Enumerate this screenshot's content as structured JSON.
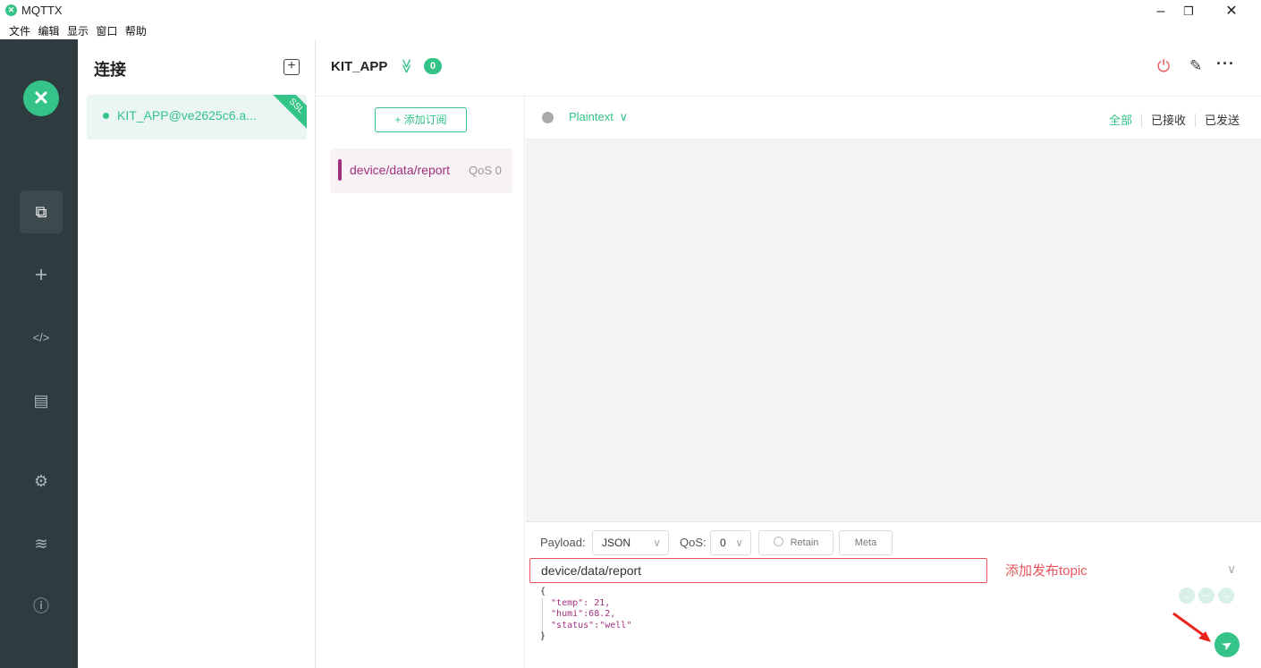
{
  "window": {
    "title": "MQTTX",
    "minimize": "–",
    "restore": "❐",
    "close": "✕"
  },
  "menu": [
    "文件",
    "编辑",
    "显示",
    "窗口",
    "帮助"
  ],
  "nav": {
    "logo": "✕",
    "items": [
      {
        "name": "connections-icon",
        "glyph": "⧉",
        "active": true
      },
      {
        "name": "new-connection-icon",
        "glyph": "+",
        "active": false
      },
      {
        "name": "script-icon",
        "glyph": "</>",
        "active": false
      },
      {
        "name": "log-icon",
        "glyph": "▤",
        "active": false
      },
      {
        "name": "settings-icon",
        "glyph": "⚙",
        "active": false
      },
      {
        "name": "feed-icon",
        "glyph": "≋",
        "active": false
      },
      {
        "name": "about-icon",
        "glyph": "ⓘ",
        "active": false
      }
    ]
  },
  "connections": {
    "title": "连接",
    "add_glyph": "+",
    "items": [
      {
        "name": "KIT_APP@ve2625c6.a...",
        "tag": "SSL",
        "status_color": "#34c388"
      }
    ]
  },
  "header": {
    "title": "KIT_APP",
    "chevron": "≫",
    "badge": "0",
    "power_glyph": "⏻",
    "edit_glyph": "✎",
    "more_glyph": "···"
  },
  "subscriptions": {
    "add_label": "+ 添加订阅",
    "items": [
      {
        "topic": "device/data/report",
        "qos": "QoS 0",
        "color": "#a0307e"
      }
    ]
  },
  "messages": {
    "format": "Plaintext",
    "format_chev": "∨",
    "filters": [
      "全部",
      "已接收",
      "已发送"
    ]
  },
  "publish": {
    "payload_label": "Payload:",
    "payload_format": "JSON",
    "qos_label": "QoS:",
    "qos_value": "0",
    "retain_label": "Retain",
    "meta_label": "Meta",
    "topic": "device/data/report",
    "annotation": "添加发布topic",
    "payload_lines": [
      "{",
      "  \"temp\": 21,",
      "  \"humi\":68.2,",
      "  \"status\":\"well\"",
      "}"
    ]
  },
  "colors": {
    "accent": "#34c388",
    "danger": "#e9545b",
    "sidebar": "#2e3b3f"
  }
}
